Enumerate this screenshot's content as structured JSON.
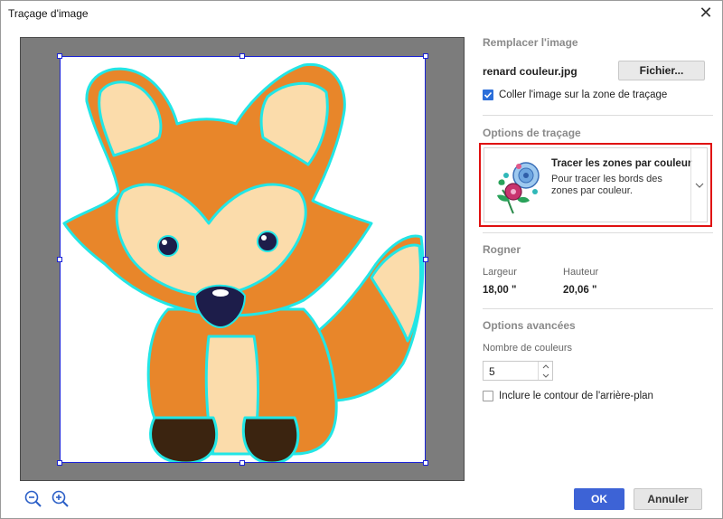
{
  "window": {
    "title": "Traçage d'image",
    "close_glyph": "✕"
  },
  "replace_image": {
    "section_title": "Remplacer l'image",
    "filename": "renard couleur.jpg",
    "file_button": "Fichier...",
    "paste_checkbox_label": "Coller l'image sur la zone de traçage",
    "paste_checked": true
  },
  "trace_options": {
    "section_title": "Options de traçage",
    "selected_title": "Tracer les zones par couleur",
    "selected_desc": "Pour tracer les bords des zones par couleur.",
    "icon": "flowers-color-icon"
  },
  "crop": {
    "section_title": "Rogner",
    "width_label": "Largeur",
    "width_value": "18,00 \"",
    "height_label": "Hauteur",
    "height_value": "20,06 \""
  },
  "advanced": {
    "section_title": "Options avancées",
    "colors_label": "Nombre de couleurs",
    "colors_value": "5",
    "background_checkbox_label": "Inclure le contour de l'arrière-plan",
    "background_checked": false
  },
  "footer": {
    "ok_label": "OK",
    "cancel_label": "Annuler"
  },
  "colors": {
    "accent": "#3d63d6",
    "highlight_border": "#e01010",
    "fox_orange": "#e8862a",
    "fox_cream": "#fbdcab",
    "trace_outline": "#22e6e6"
  }
}
